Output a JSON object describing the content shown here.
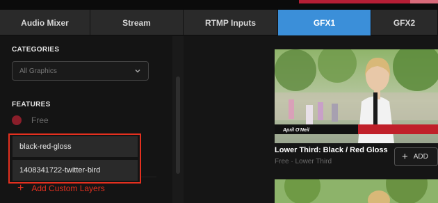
{
  "tabs": [
    {
      "label": "Audio Mixer",
      "active": false
    },
    {
      "label": "Stream",
      "active": false
    },
    {
      "label": "RTMP Inputs",
      "active": false
    },
    {
      "label": "GFX1",
      "active": true
    },
    {
      "label": "GFX2",
      "active": false
    }
  ],
  "categories": {
    "title": "CATEGORIES",
    "selected": "All Graphics"
  },
  "features": {
    "title": "FEATURES",
    "items": [
      {
        "label": "Free"
      }
    ]
  },
  "custom_layers": [
    {
      "label": "black-red-gloss"
    },
    {
      "label": "1408341722-twitter-bird"
    }
  ],
  "add_custom_layers_label": "Add Custom Layers",
  "gfx_card": {
    "title": "Lower Third: Black / Red Gloss",
    "subtitle": "Free · Lower Third",
    "lower_third_name": "April O'Neil",
    "add_label": "ADD"
  },
  "colors": {
    "accent_blue": "#3b8fd9",
    "accent_red": "#e3301f"
  }
}
